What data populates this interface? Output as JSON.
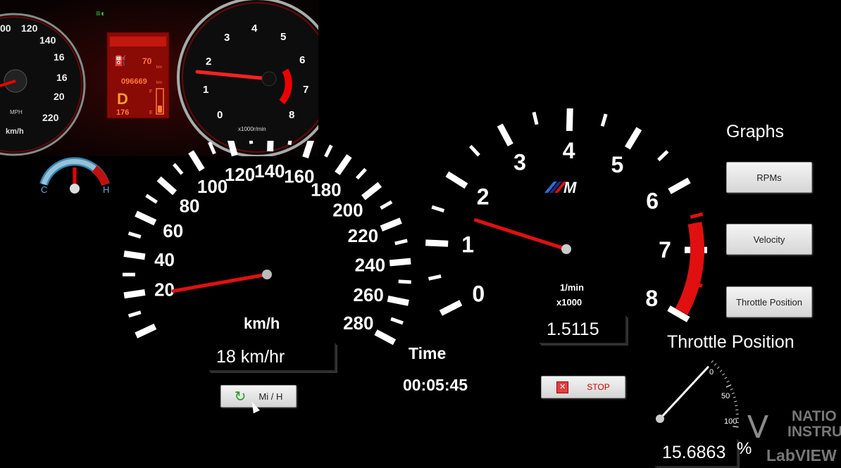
{
  "inset": {
    "dash_km": "70",
    "dash_km_unit": "km",
    "odometer": "096669",
    "odometer_unit": "km",
    "gear": "D",
    "trip": "176",
    "speedo_labels": [
      "00",
      "120",
      "140",
      "16",
      "16",
      "20",
      "220"
    ],
    "mph_label": "MPH",
    "kmh_label": "km/h",
    "tach_labels": [
      "0",
      "1",
      "2",
      "3",
      "4",
      "5",
      "6",
      "7",
      "8"
    ],
    "tach_unit": "x1000r/min",
    "fuel_f": "F",
    "fuel_e": "E"
  },
  "temp_gauge": {
    "cold": "C",
    "hot": "H"
  },
  "speedometer": {
    "labels": [
      "20",
      "40",
      "60",
      "80",
      "100",
      "120",
      "140",
      "160",
      "180",
      "200",
      "220",
      "240",
      "260",
      "280"
    ],
    "unit": "km/h",
    "value_kmh": 18,
    "readout": "18 km/hr",
    "unit_button": "Mi / H"
  },
  "time": {
    "label": "Time",
    "value": "00:05:45"
  },
  "tachometer": {
    "labels": [
      "0",
      "1",
      "2",
      "3",
      "4",
      "5",
      "6",
      "7",
      "8"
    ],
    "logo": "M",
    "unit_line1": "1/min",
    "unit_line2": "x1000",
    "value": 1.5115,
    "readout": "1.5115",
    "stop_button": "STOP"
  },
  "graphs": {
    "title": "Graphs",
    "buttons": [
      "RPMs",
      "Velocity",
      "Throttle Position"
    ]
  },
  "throttle": {
    "title": "Throttle Position",
    "scale": [
      "0",
      "50",
      "100"
    ],
    "value": 15.6863,
    "readout": "15.6863",
    "unit": "%"
  },
  "branding": {
    "line1": "NATIO",
    "line2": "INSTRU",
    "line3": "LabVIEW"
  },
  "colors": {
    "accent_red": "#e01010",
    "panel_bg": "#000000",
    "button_face": "#e6e6e6"
  }
}
